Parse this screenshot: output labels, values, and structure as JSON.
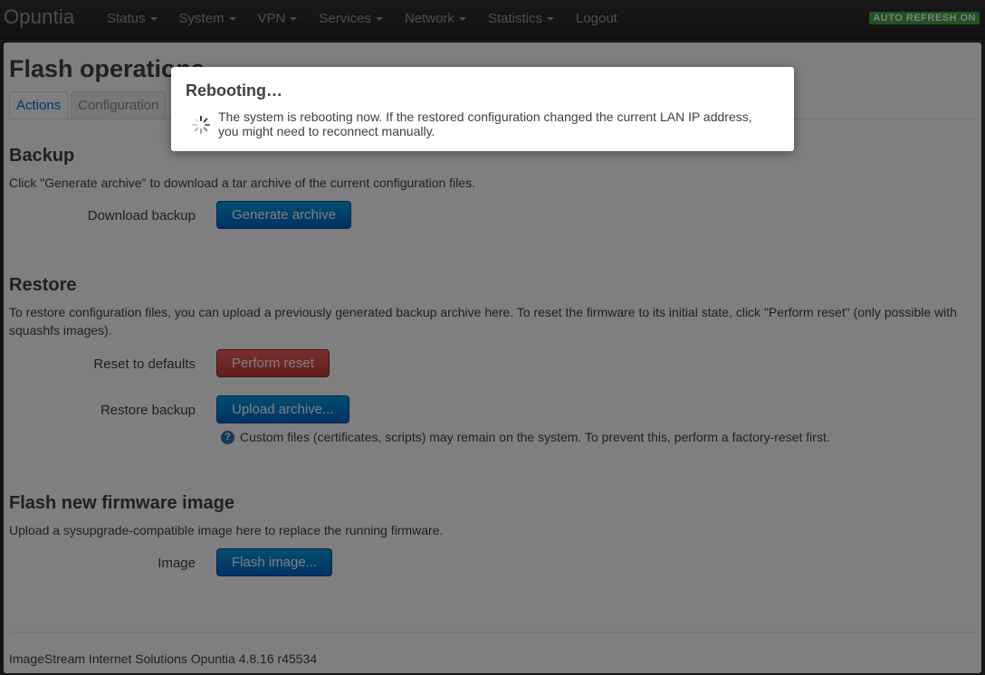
{
  "navbar": {
    "brand": "Opuntia",
    "items": [
      {
        "label": "Status",
        "dropdown": true
      },
      {
        "label": "System",
        "dropdown": true
      },
      {
        "label": "VPN",
        "dropdown": true
      },
      {
        "label": "Services",
        "dropdown": true
      },
      {
        "label": "Network",
        "dropdown": true
      },
      {
        "label": "Statistics",
        "dropdown": true
      },
      {
        "label": "Logout",
        "dropdown": false
      }
    ],
    "auto_refresh": "AUTO REFRESH ON"
  },
  "page": {
    "title": "Flash operations",
    "tabs": [
      {
        "label": "Actions",
        "active": true
      },
      {
        "label": "Configuration",
        "active": false
      }
    ]
  },
  "backup": {
    "title": "Backup",
    "description": "Click \"Generate archive\" to download a tar archive of the current configuration files.",
    "download_label": "Download backup",
    "generate_button": "Generate archive"
  },
  "restore": {
    "title": "Restore",
    "description": "To restore configuration files, you can upload a previously generated backup archive here. To reset the firmware to its initial state, click \"Perform reset\" (only possible with squashfs images).",
    "reset_label": "Reset to defaults",
    "reset_button": "Perform reset",
    "restore_label": "Restore backup",
    "upload_button": "Upload archive...",
    "hint": "Custom files (certificates, scripts) may remain on the system. To prevent this, perform a factory-reset first."
  },
  "flash": {
    "title": "Flash new firmware image",
    "description": "Upload a sysupgrade-compatible image here to replace the running firmware.",
    "image_label": "Image",
    "flash_button": "Flash image..."
  },
  "footer": {
    "text": "ImageStream Internet Solutions Opuntia 4.8.16 r45534"
  },
  "modal": {
    "title": "Rebooting…",
    "message": "The system is rebooting now. If the restored configuration changed the current LAN IP address, you might need to reconnect manually.",
    "icon": "spinner-icon"
  },
  "colors": {
    "primary_button": "#0064cd",
    "danger_button": "#c43c35",
    "auto_refresh_badge": "#46a546",
    "link": "#0069d6"
  }
}
